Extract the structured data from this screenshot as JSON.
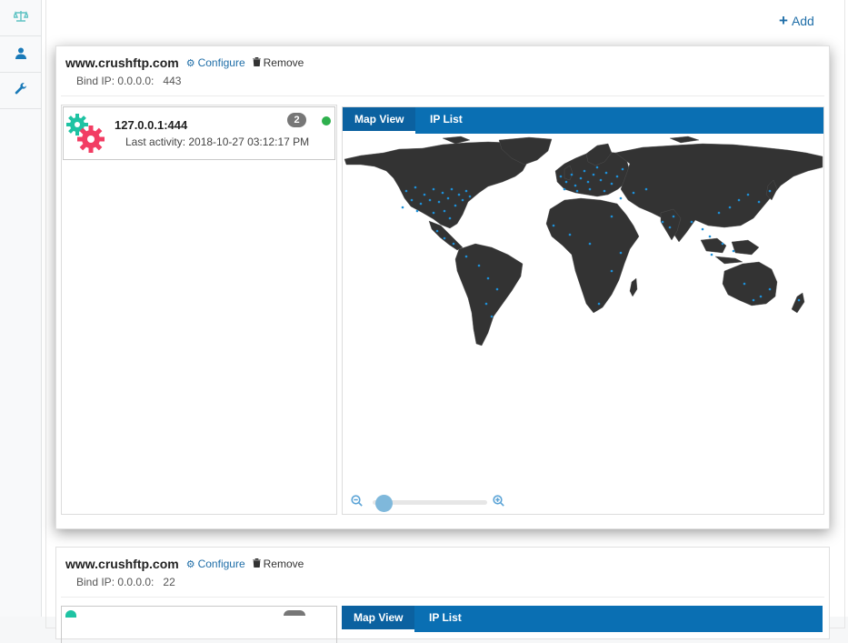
{
  "sidebar": {
    "items": [
      {
        "icon": "scale-icon"
      },
      {
        "icon": "user-icon"
      },
      {
        "icon": "wrench-icon"
      }
    ]
  },
  "toolbar": {
    "add_label": "Add"
  },
  "servers": [
    {
      "host": "www.crushftp.com",
      "configure_label": "Configure",
      "remove_label": "Remove",
      "bind_label": "Bind IP: 0.0.0.0:",
      "port": "443",
      "item": {
        "address": "127.0.0.1:444",
        "last_activity": "Last activity: 2018-10-27 03:12:17 PM",
        "badge_count": "2",
        "status_color": "#2eb04d"
      },
      "tabs": [
        "Map View",
        "IP List"
      ],
      "active_tab": "Map View",
      "zoom_level": 0.05
    },
    {
      "host": "www.crushftp.com",
      "configure_label": "Configure",
      "remove_label": "Remove",
      "bind_label": "Bind IP: 0.0.0.0:",
      "port": "22",
      "tabs": [
        "Map View",
        "IP List"
      ]
    }
  ],
  "colors": {
    "accent": "#0a6fb3",
    "land": "#333333",
    "connection_dot": "#1e90d8",
    "gear_teal": "#1fc3a3",
    "gear_red": "#f23d63"
  }
}
